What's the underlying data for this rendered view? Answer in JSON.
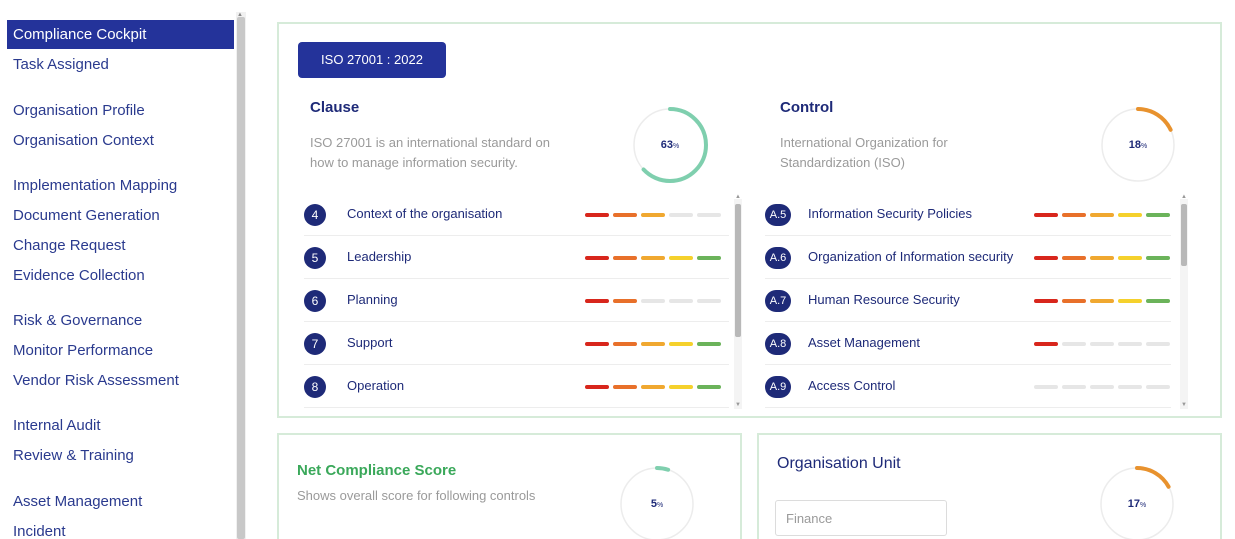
{
  "sidebar": {
    "items": [
      {
        "label": "Compliance Cockpit",
        "active": true
      },
      {
        "label": "Task Assigned"
      },
      {
        "label": "Organisation Profile"
      },
      {
        "label": "Organisation Context"
      },
      {
        "label": "Implementation Mapping"
      },
      {
        "label": "Document Generation"
      },
      {
        "label": "Change Request"
      },
      {
        "label": "Evidence Collection"
      },
      {
        "label": "Risk & Governance"
      },
      {
        "label": "Monitor Performance"
      },
      {
        "label": "Vendor Risk Assessment"
      },
      {
        "label": "Internal Audit"
      },
      {
        "label": "Review & Training"
      },
      {
        "label": "Asset Management"
      },
      {
        "label": "Incident"
      }
    ]
  },
  "standard_badge": "ISO 27001 : 2022",
  "clause": {
    "title": "Clause",
    "description_line1": "ISO 27001 is an international standard on",
    "description_line2": "how to manage information security.",
    "progress": {
      "value": "63",
      "unit": "%",
      "fraction": 0.63,
      "color": "#7fcfae"
    },
    "rows": [
      {
        "num": "4",
        "label": "Context of the organisation",
        "bars": [
          "#d8261c",
          "#e8702a",
          "#f0a830",
          "#e6e6e6",
          "#e6e6e6"
        ]
      },
      {
        "num": "5",
        "label": "Leadership",
        "bars": [
          "#d8261c",
          "#e8702a",
          "#f0a830",
          "#f5d12c",
          "#6bb35a"
        ]
      },
      {
        "num": "6",
        "label": "Planning",
        "bars": [
          "#d8261c",
          "#e8702a",
          "#e6e6e6",
          "#e6e6e6",
          "#e6e6e6"
        ]
      },
      {
        "num": "7",
        "label": "Support",
        "bars": [
          "#d8261c",
          "#e8702a",
          "#f0a830",
          "#f5d12c",
          "#6bb35a"
        ]
      },
      {
        "num": "8",
        "label": "Operation",
        "bars": [
          "#d8261c",
          "#e8702a",
          "#f0a830",
          "#f5d12c",
          "#6bb35a"
        ]
      }
    ]
  },
  "control": {
    "title": "Control",
    "description_line1": "International Organization for",
    "description_line2": "Standardization (ISO)",
    "progress": {
      "value": "18",
      "unit": "%",
      "fraction": 0.18,
      "color": "#e8922e"
    },
    "rows": [
      {
        "num": "A.5",
        "label": "Information Security Policies",
        "bars": [
          "#d8261c",
          "#e8702a",
          "#f0a830",
          "#f5d12c",
          "#6bb35a"
        ]
      },
      {
        "num": "A.6",
        "label": "Organization of Information security",
        "bars": [
          "#d8261c",
          "#e8702a",
          "#f0a830",
          "#f5d12c",
          "#6bb35a"
        ]
      },
      {
        "num": "A.7",
        "label": "Human Resource Security",
        "bars": [
          "#d8261c",
          "#e8702a",
          "#f0a830",
          "#f5d12c",
          "#6bb35a"
        ]
      },
      {
        "num": "A.8",
        "label": "Asset Management",
        "bars": [
          "#d8261c",
          "#e6e6e6",
          "#e6e6e6",
          "#e6e6e6",
          "#e6e6e6"
        ]
      },
      {
        "num": "A.9",
        "label": "Access Control",
        "bars": [
          "#e6e6e6",
          "#e6e6e6",
          "#e6e6e6",
          "#e6e6e6",
          "#e6e6e6"
        ]
      }
    ]
  },
  "net_compliance": {
    "title": "Net Compliance Score",
    "description": "Shows overall score for following controls",
    "progress": {
      "value": "5",
      "unit": "%",
      "fraction": 0.05,
      "color": "#7fcfae"
    }
  },
  "org_unit": {
    "title": "Organisation Unit",
    "input_placeholder": "Finance",
    "progress": {
      "value": "17",
      "unit": "%",
      "fraction": 0.17,
      "color": "#e8922e"
    }
  },
  "colors": {
    "primary": "#24339a",
    "panel_border": "#d6ebd9",
    "green_title": "#3aa85a"
  }
}
